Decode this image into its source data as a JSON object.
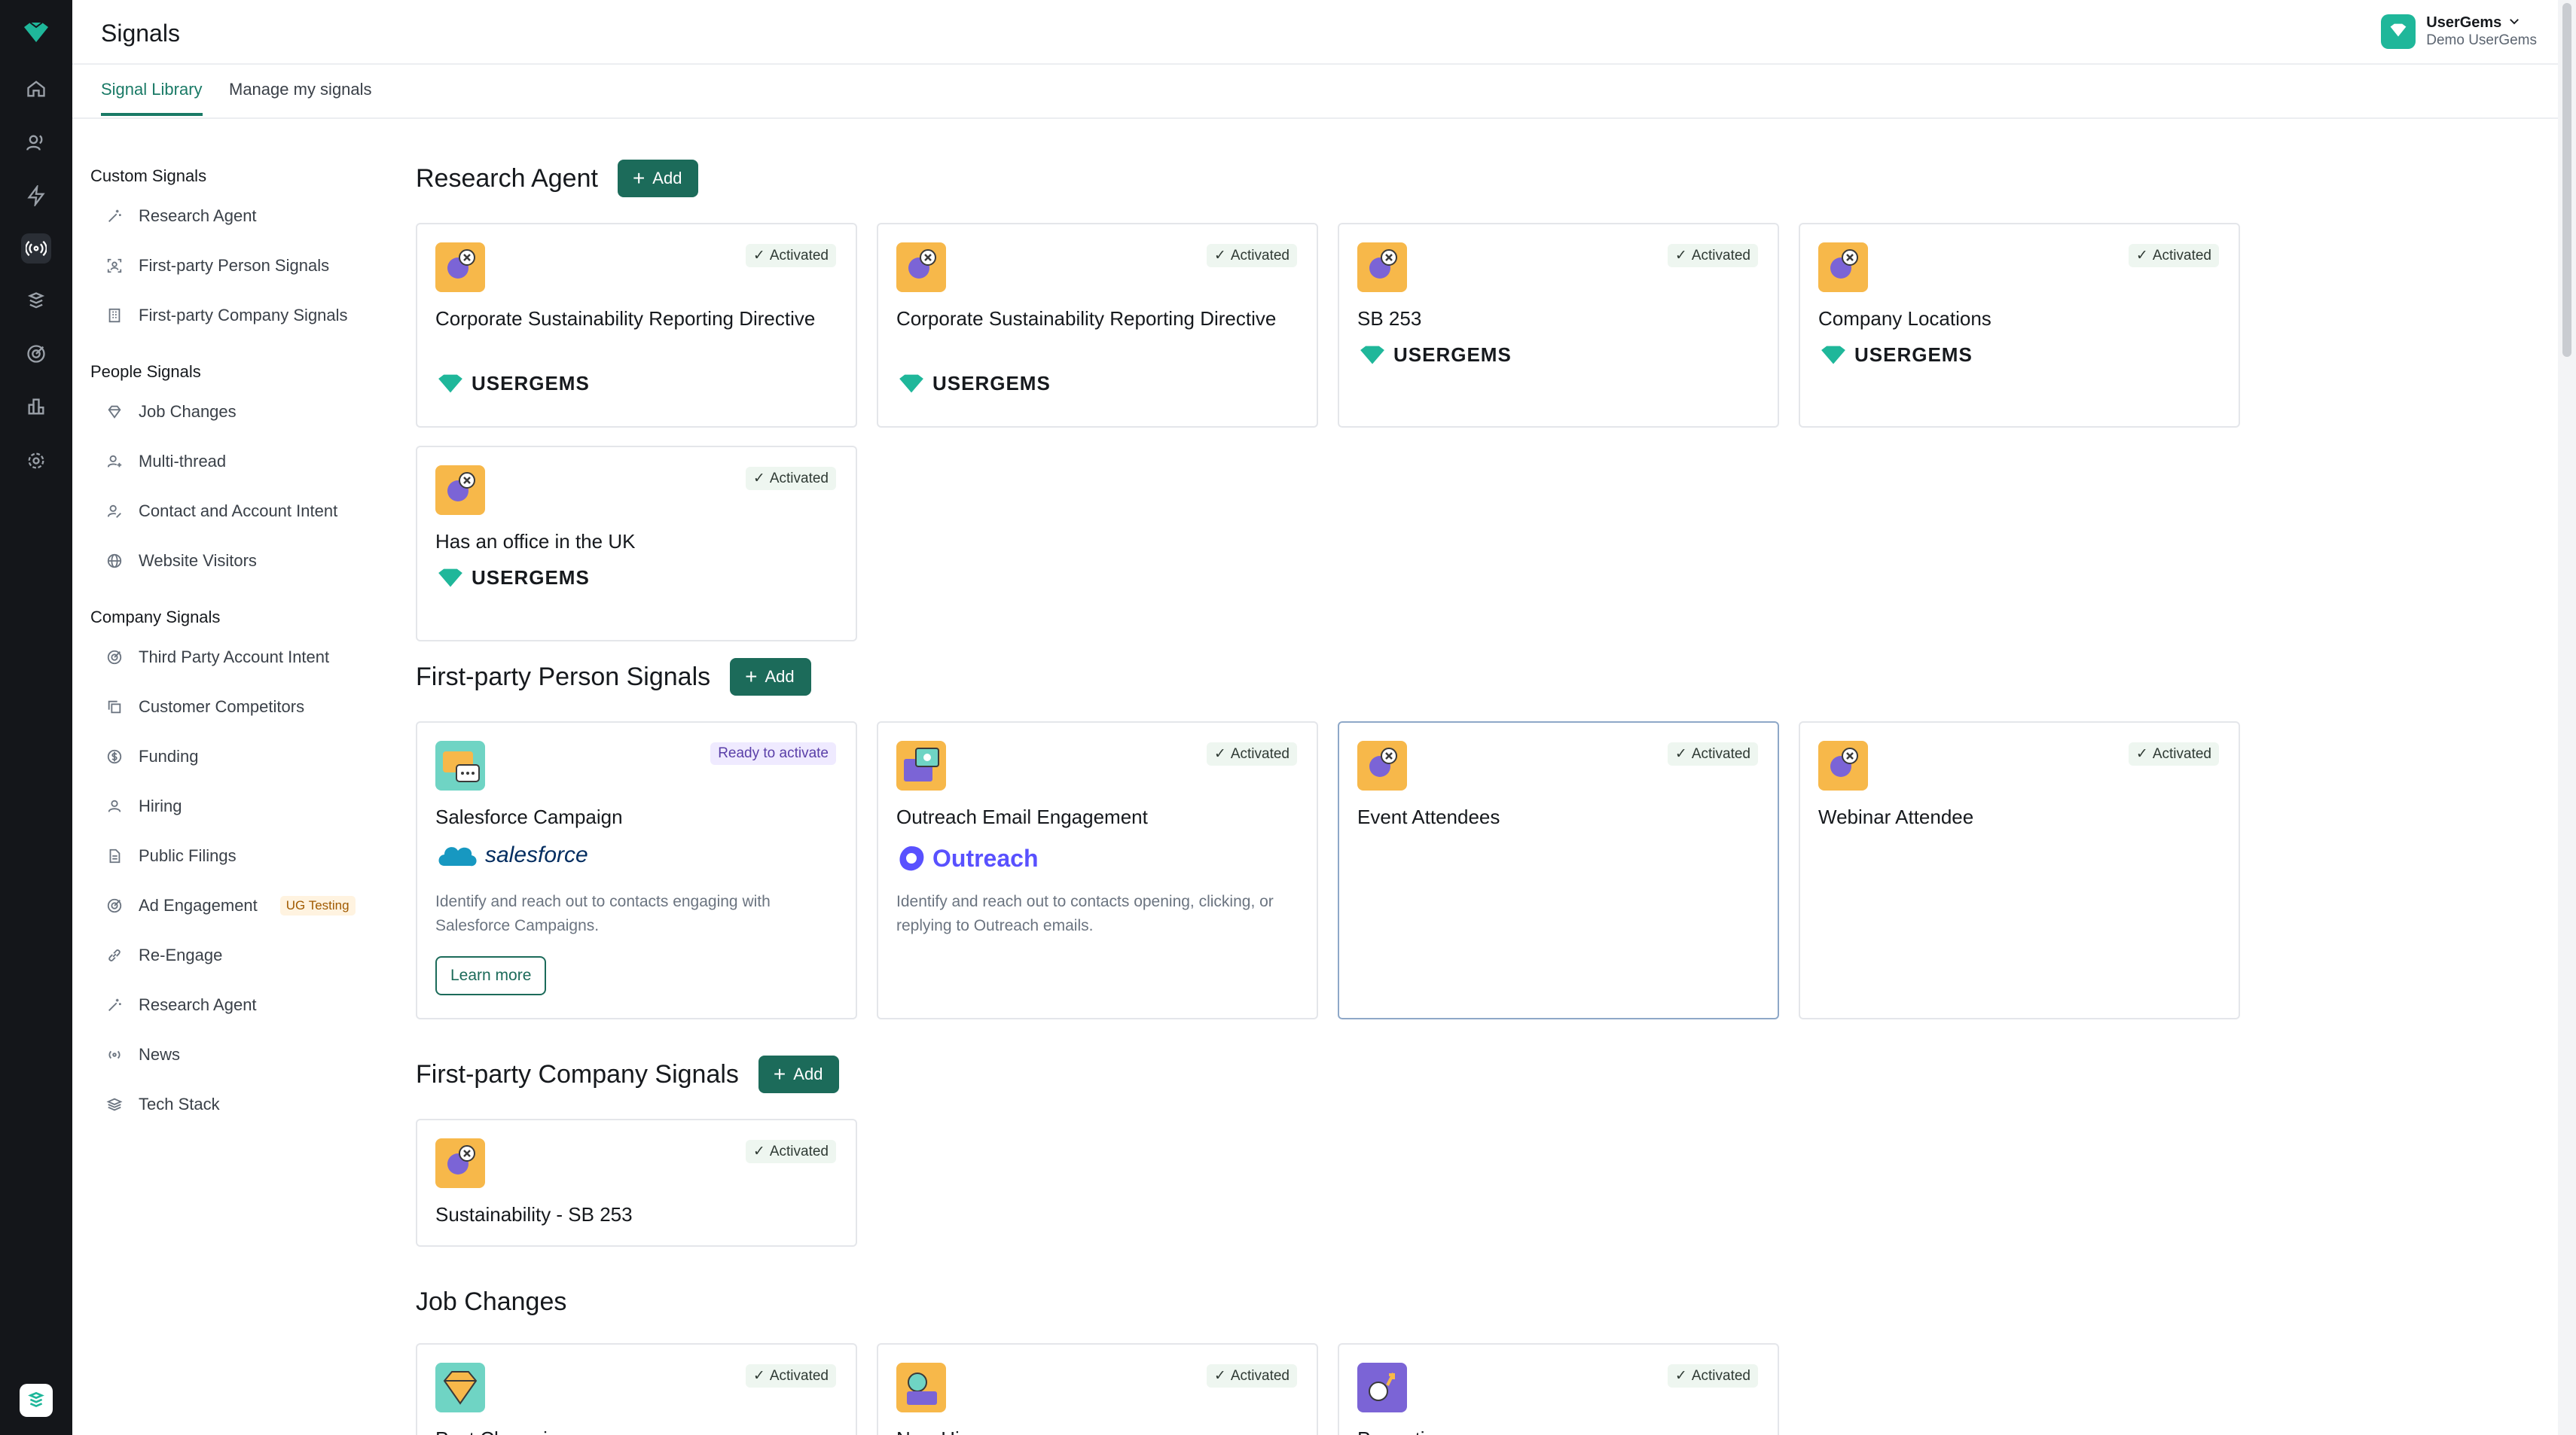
{
  "header": {
    "title": "Signals"
  },
  "account": {
    "name": "UserGems",
    "org": "Demo UserGems"
  },
  "tabs": [
    {
      "label": "Signal Library"
    },
    {
      "label": "Manage my signals"
    }
  ],
  "sidebar": {
    "custom": {
      "heading": "Custom Signals",
      "items": [
        {
          "label": "Research Agent",
          "icon": "wand-icon"
        },
        {
          "label": "First-party Person Signals",
          "icon": "person-scan-icon"
        },
        {
          "label": "First-party Company Signals",
          "icon": "building-icon"
        }
      ]
    },
    "people": {
      "heading": "People Signals",
      "items": [
        {
          "label": "Job Changes",
          "icon": "gem-icon"
        },
        {
          "label": "Multi-thread",
          "icon": "person-plus-icon"
        },
        {
          "label": "Contact and Account Intent",
          "icon": "person-edit-icon"
        },
        {
          "label": "Website Visitors",
          "icon": "globe-icon"
        }
      ]
    },
    "company": {
      "heading": "Company Signals",
      "items": [
        {
          "label": "Third Party Account Intent",
          "icon": "target-icon"
        },
        {
          "label": "Customer Competitors",
          "icon": "copy-icon"
        },
        {
          "label": "Funding",
          "icon": "dollar-icon"
        },
        {
          "label": "Hiring",
          "icon": "person-icon"
        },
        {
          "label": "Public Filings",
          "icon": "document-icon"
        },
        {
          "label": "Ad Engagement",
          "icon": "target-icon",
          "badge": "UG Testing"
        },
        {
          "label": "Re-Engage",
          "icon": "link-icon"
        },
        {
          "label": "Research Agent",
          "icon": "wand-icon"
        },
        {
          "label": "News",
          "icon": "broadcast-icon"
        },
        {
          "label": "Tech Stack",
          "icon": "layers-icon"
        }
      ]
    }
  },
  "sections": {
    "research": {
      "title": "Research Agent",
      "add_label": "Add",
      "cards": [
        {
          "title": "Corporate Sustainability Reporting Directive",
          "status": "Activated",
          "brand": "USERGEMS"
        },
        {
          "title": "Corporate Sustainability Reporting Directive",
          "status": "Activated",
          "brand": "USERGEMS"
        },
        {
          "title": "SB 253",
          "status": "Activated",
          "brand": "USERGEMS"
        },
        {
          "title": "Company Locations",
          "status": "Activated",
          "brand": "USERGEMS"
        },
        {
          "title": "Has an office in the UK",
          "status": "Activated",
          "brand": "USERGEMS"
        }
      ]
    },
    "person": {
      "title": "First-party Person Signals",
      "add_label": "Add",
      "cards": [
        {
          "title": "Salesforce Campaign",
          "status": "Ready to activate",
          "brand": "salesforce",
          "desc": "Identify and reach out to contacts engaging with Salesforce Campaigns.",
          "button": "Learn more"
        },
        {
          "title": "Outreach Email Engagement",
          "status": "Activated",
          "brand": "Outreach",
          "desc": "Identify and reach out to contacts opening, clicking, or replying to Outreach emails."
        },
        {
          "title": "Event Attendees",
          "status": "Activated"
        },
        {
          "title": "Webinar Attendee",
          "status": "Activated"
        }
      ]
    },
    "company": {
      "title": "First-party Company Signals",
      "add_label": "Add",
      "cards": [
        {
          "title": "Sustainability - SB 253",
          "status": "Activated"
        }
      ]
    },
    "jobs": {
      "title": "Job Changes",
      "cards": [
        {
          "title": "Past Champions",
          "status": "Activated"
        },
        {
          "title": "New Hires",
          "status": "Activated"
        },
        {
          "title": "Promotions",
          "status": "Activated"
        }
      ]
    }
  },
  "colors": {
    "accent": "#1c6b5a",
    "rail": "#14161a",
    "brand_gem": "#1fb79a",
    "icon_bg": "#f7b84a"
  }
}
